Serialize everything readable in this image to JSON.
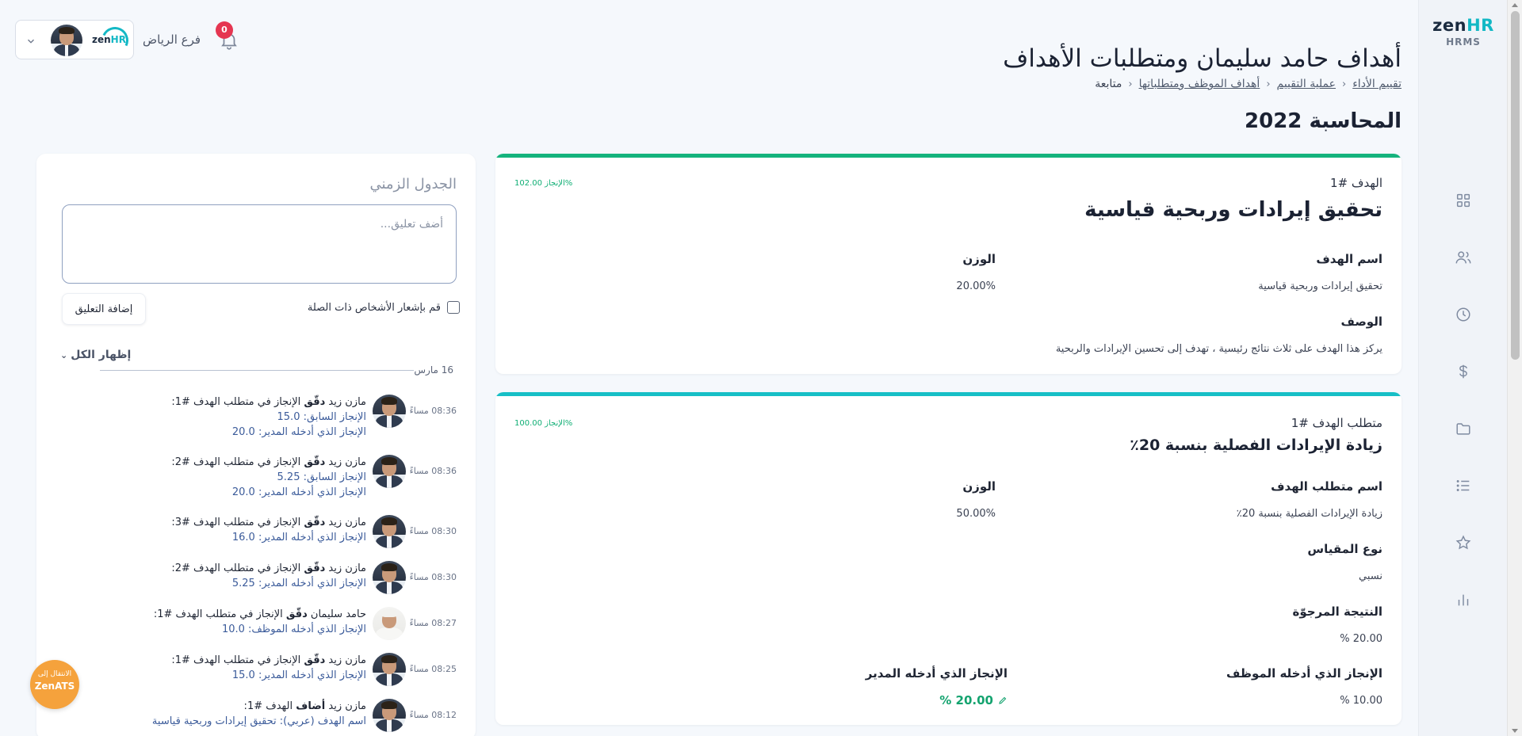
{
  "header": {
    "title": "أهداف حامد سليمان ومتطلبات الأهداف",
    "breadcrumb": [
      "تقييم الأداء",
      "عملية التقييم",
      "أهداف الموظف ومتطلباتها",
      "متابعة"
    ],
    "section_title": "المحاسبة 2022"
  },
  "topbar": {
    "branch": "فرع الرياض",
    "notification_count": "0",
    "logo_text_zen": "zen",
    "logo_text_hr": "HR"
  },
  "sidebar": {
    "brand_zen": "zen",
    "brand_hr": "HR",
    "brand_sub": "HRMS",
    "items": [
      {
        "icon": "grid-icon"
      },
      {
        "icon": "users-icon"
      },
      {
        "icon": "clock-icon"
      },
      {
        "icon": "dollar-icon"
      },
      {
        "icon": "folder-icon"
      },
      {
        "icon": "list-icon"
      },
      {
        "icon": "star-icon"
      },
      {
        "icon": "bar-chart-icon"
      }
    ]
  },
  "goal_card": {
    "accent": "#15b37d",
    "label": "الهدف #1",
    "title": "تحقيق إيرادات وربحية قياسية",
    "achievement": "الإنجاز 102.00%",
    "name_label": "اسم الهدف",
    "name_value": "تحقيق إيرادات وربحية قياسية",
    "weight_label": "الوزن",
    "weight_value": "20.00%",
    "desc_label": "الوصف",
    "desc_value": "يركز هذا الهدف على ثلاث نتائج رئيسية ، تهدف إلى تحسين الإيرادات والربحية"
  },
  "requirement_card": {
    "accent": "#17bfc6",
    "label": "متطلب الهدف #1",
    "title": "زيادة الإيرادات الفصلية بنسبة 20٪",
    "achievement": "الإنجاز 100.00%",
    "name_label": "اسم متطلب الهدف",
    "name_value": "زيادة الإيرادات الفصلية بنسبة 20٪",
    "weight_label": "الوزن",
    "weight_value": "50.00%",
    "metric_label": "نوع المقياس",
    "metric_value": "نسبي",
    "expected_label": "النتيجة المرجوّة",
    "expected_value": "% 20.00",
    "emp_label": "الإنجاز الذي أدخله الموظف",
    "emp_value": "% 10.00",
    "mgr_label": "الإنجاز الذي أدخله المدير",
    "mgr_value": "% 20.00"
  },
  "timeline": {
    "title": "الجدول الزمني",
    "placeholder": "أضف تعليق...",
    "add_button": "إضافة التعليق",
    "notify_label": "قم بإشعار الأشخاص ذات الصلة",
    "show_all": "إظهار الكل",
    "date": "16 مارس",
    "items": [
      {
        "time": "08:36 مساءً",
        "l1_prefix": "مازن زيد ",
        "l1_action": "دقّق",
        "l1_suffix": " الإنجاز في متطلب الهدف #1:",
        "k2": "الإنجاز السابق:",
        "v2": " 15.0",
        "k3": "الإنجاز الذي أدخله المدير:",
        "v3": " 20.0"
      },
      {
        "time": "08:36 مساءً",
        "l1_prefix": "مازن زيد ",
        "l1_action": "دقّق",
        "l1_suffix": " الإنجاز في متطلب الهدف #2:",
        "k2": "الإنجاز السابق:",
        "v2": " 5.25",
        "k3": "الإنجاز الذي أدخله المدير:",
        "v3": " 20.0"
      },
      {
        "time": "08:30 مساءً",
        "l1_prefix": "مازن زيد ",
        "l1_action": "دقّق",
        "l1_suffix": " الإنجاز في متطلب الهدف #3:",
        "k2": "الإنجاز الذي أدخله المدير:",
        "v2": " 16.0"
      },
      {
        "time": "08:30 مساءً",
        "l1_prefix": "مازن زيد ",
        "l1_action": "دقّق",
        "l1_suffix": " الإنجاز في متطلب الهدف #2:",
        "k2": "الإنجاز الذي أدخله المدير:",
        "v2": " 5.25"
      },
      {
        "time": "08:27 مساءً",
        "l1_prefix": "حامد سليمان ",
        "l1_action": "دقّق",
        "l1_suffix": " الإنجاز في متطلب الهدف #1:",
        "k2": "الإنجاز الذي أدخله الموظف:",
        "v2": " 10.0"
      },
      {
        "time": "08:25 مساءً",
        "l1_prefix": "مازن زيد ",
        "l1_action": "دقّق",
        "l1_suffix": " الإنجاز في متطلب الهدف #1:",
        "k2": "الإنجاز الذي أدخله المدير:",
        "v2": " 15.0"
      },
      {
        "time": "08:12 مساءً",
        "l1_prefix": "مازن زيد ",
        "l1_action": "أضاف",
        "l1_suffix": " الهدف #1:",
        "k2": "اسم الهدف (عربي):",
        "v2": " تحقيق إيرادات وربحية قياسية"
      }
    ]
  },
  "ats_badge": {
    "line1": "الانتقال إلى",
    "line2": "ZenATS"
  }
}
